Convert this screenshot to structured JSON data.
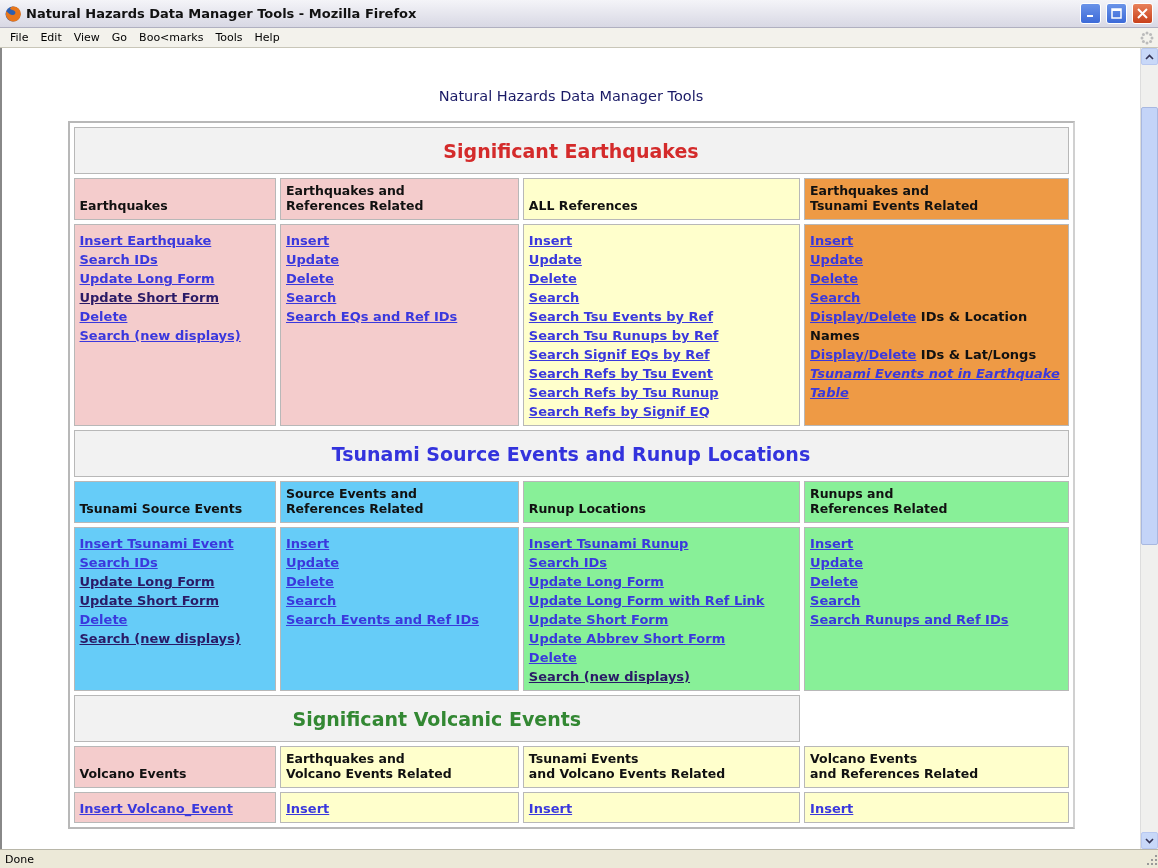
{
  "window": {
    "title": "Natural Hazards Data Manager Tools - Mozilla Firefox"
  },
  "menu": [
    "File",
    "Edit",
    "View",
    "Go",
    "Boo<marks",
    "Tools",
    "Help"
  ],
  "page_title": "Natural Hazards Data Manager Tools",
  "sections": [
    {
      "title": "Significant Earthquakes",
      "color": "#d42b2b",
      "full_width": true,
      "columns": [
        {
          "heading": "Earthquakes",
          "color": "#f4cccc",
          "items": [
            {
              "kind": "link",
              "text": "Insert Earthquake",
              "visited": false
            },
            {
              "kind": "link",
              "text": "Search IDs",
              "visited": false
            },
            {
              "kind": "link",
              "text": "Update Long Form",
              "visited": false
            },
            {
              "kind": "link",
              "text": "Update Short Form",
              "visited": true
            },
            {
              "kind": "link",
              "text": "Delete",
              "visited": false
            },
            {
              "kind": "link",
              "text": "Search (new displays)",
              "visited": false
            }
          ]
        },
        {
          "heading": "Earthquakes and\nReferences Related",
          "color": "#f4cccc",
          "items": [
            {
              "kind": "link",
              "text": "Insert",
              "visited": false
            },
            {
              "kind": "link",
              "text": "Update",
              "visited": false
            },
            {
              "kind": "link",
              "text": "Delete",
              "visited": false
            },
            {
              "kind": "link",
              "text": "Search",
              "visited": false
            },
            {
              "kind": "link",
              "text": "Search EQs and Ref IDs",
              "visited": false
            }
          ]
        },
        {
          "heading": "ALL References",
          "color": "#ffffcc",
          "items": [
            {
              "kind": "link",
              "text": "Insert",
              "visited": false
            },
            {
              "kind": "link",
              "text": "Update",
              "visited": false
            },
            {
              "kind": "link",
              "text": "Delete",
              "visited": false
            },
            {
              "kind": "link",
              "text": "Search",
              "visited": false
            },
            {
              "kind": "link",
              "text": "Search Tsu Events by Ref",
              "visited": false
            },
            {
              "kind": "link",
              "text": "Search Tsu Runups by Ref",
              "visited": false
            },
            {
              "kind": "link",
              "text": "Search Signif EQs by Ref",
              "visited": false
            },
            {
              "kind": "link",
              "text": "Search Refs by Tsu Event",
              "visited": false
            },
            {
              "kind": "link",
              "text": "Search Refs by Tsu Runup",
              "visited": false
            },
            {
              "kind": "link",
              "text": "Search Refs by Signif EQ",
              "visited": false
            }
          ]
        },
        {
          "heading": "Earthquakes and\nTsunami Events Related",
          "color": "#ee9a45",
          "items": [
            {
              "kind": "link",
              "text": "Insert",
              "visited": false
            },
            {
              "kind": "link",
              "text": "Update",
              "visited": false
            },
            {
              "kind": "link",
              "text": "Delete",
              "visited": false
            },
            {
              "kind": "link",
              "text": "Search",
              "visited": false
            },
            {
              "kind": "link-note",
              "text": "Display/Delete",
              "note": "IDs & Location Names",
              "visited": false
            },
            {
              "kind": "link-note",
              "text": "Display/Delete",
              "note": "IDs & Lat/Longs",
              "visited": false
            },
            {
              "kind": "italic-link",
              "text": "Tsunami Events not in Earthquake Table",
              "visited": false
            }
          ]
        }
      ]
    },
    {
      "title": "Tsunami Source Events and Runup Locations",
      "color": "#3333dd",
      "full_width": true,
      "columns": [
        {
          "heading": "Tsunami Source Events",
          "color": "#66ccf8",
          "items": [
            {
              "kind": "link",
              "text": "Insert Tsunami Event",
              "visited": false
            },
            {
              "kind": "link",
              "text": "Search IDs",
              "visited": false
            },
            {
              "kind": "link",
              "text": "Update Long Form",
              "visited": true
            },
            {
              "kind": "link",
              "text": "Update Short Form",
              "visited": true
            },
            {
              "kind": "link",
              "text": "Delete",
              "visited": false
            },
            {
              "kind": "link",
              "text": "Search (new displays)",
              "visited": true
            }
          ]
        },
        {
          "heading": "Source Events and\nReferences Related",
          "color": "#66ccf8",
          "items": [
            {
              "kind": "link",
              "text": "Insert",
              "visited": false
            },
            {
              "kind": "link",
              "text": "Update",
              "visited": false
            },
            {
              "kind": "link",
              "text": "Delete",
              "visited": false
            },
            {
              "kind": "link",
              "text": "Search",
              "visited": false
            },
            {
              "kind": "link",
              "text": "Search Events and Ref IDs",
              "visited": false
            }
          ]
        },
        {
          "heading": "Runup Locations",
          "color": "#88f098",
          "items": [
            {
              "kind": "link",
              "text": "Insert Tsunami Runup",
              "visited": false
            },
            {
              "kind": "link",
              "text": "Search IDs",
              "visited": false
            },
            {
              "kind": "link",
              "text": "Update Long Form",
              "visited": false
            },
            {
              "kind": "link",
              "text": "Update Long Form with Ref Link",
              "visited": false
            },
            {
              "kind": "link",
              "text": "Update Short Form",
              "visited": false
            },
            {
              "kind": "link",
              "text": "Update Abbrev Short Form",
              "visited": false
            },
            {
              "kind": "link",
              "text": "Delete",
              "visited": false
            },
            {
              "kind": "link",
              "text": "Search (new displays)",
              "visited": true
            }
          ]
        },
        {
          "heading": "Runups and\nReferences Related",
          "color": "#88f098",
          "items": [
            {
              "kind": "link",
              "text": "Insert",
              "visited": false
            },
            {
              "kind": "link",
              "text": "Update",
              "visited": false
            },
            {
              "kind": "link",
              "text": "Delete",
              "visited": false
            },
            {
              "kind": "link",
              "text": "Search",
              "visited": false
            },
            {
              "kind": "link",
              "text": "Search Runups and Ref IDs",
              "visited": false
            }
          ]
        }
      ]
    },
    {
      "title": "Significant Volcanic Events",
      "color": "#338833",
      "full_width": false,
      "columns": [
        {
          "heading": "Volcano Events",
          "color": "#f4cccc",
          "items": [
            {
              "kind": "link",
              "text": "Insert Volcano_Event",
              "visited": false
            }
          ]
        },
        {
          "heading": "Earthquakes and\nVolcano Events Related",
          "color": "#ffffcc",
          "items": [
            {
              "kind": "link",
              "text": "Insert",
              "visited": false
            }
          ]
        },
        {
          "heading": "Tsunami Events\nand Volcano Events Related",
          "color": "#ffffcc",
          "items": [
            {
              "kind": "link",
              "text": "Insert",
              "visited": false
            }
          ]
        },
        {
          "heading": "Volcano Events\nand References Related",
          "color": "#ffffcc",
          "items": [
            {
              "kind": "link",
              "text": "Insert",
              "visited": false
            }
          ]
        }
      ]
    }
  ],
  "status": "Done"
}
